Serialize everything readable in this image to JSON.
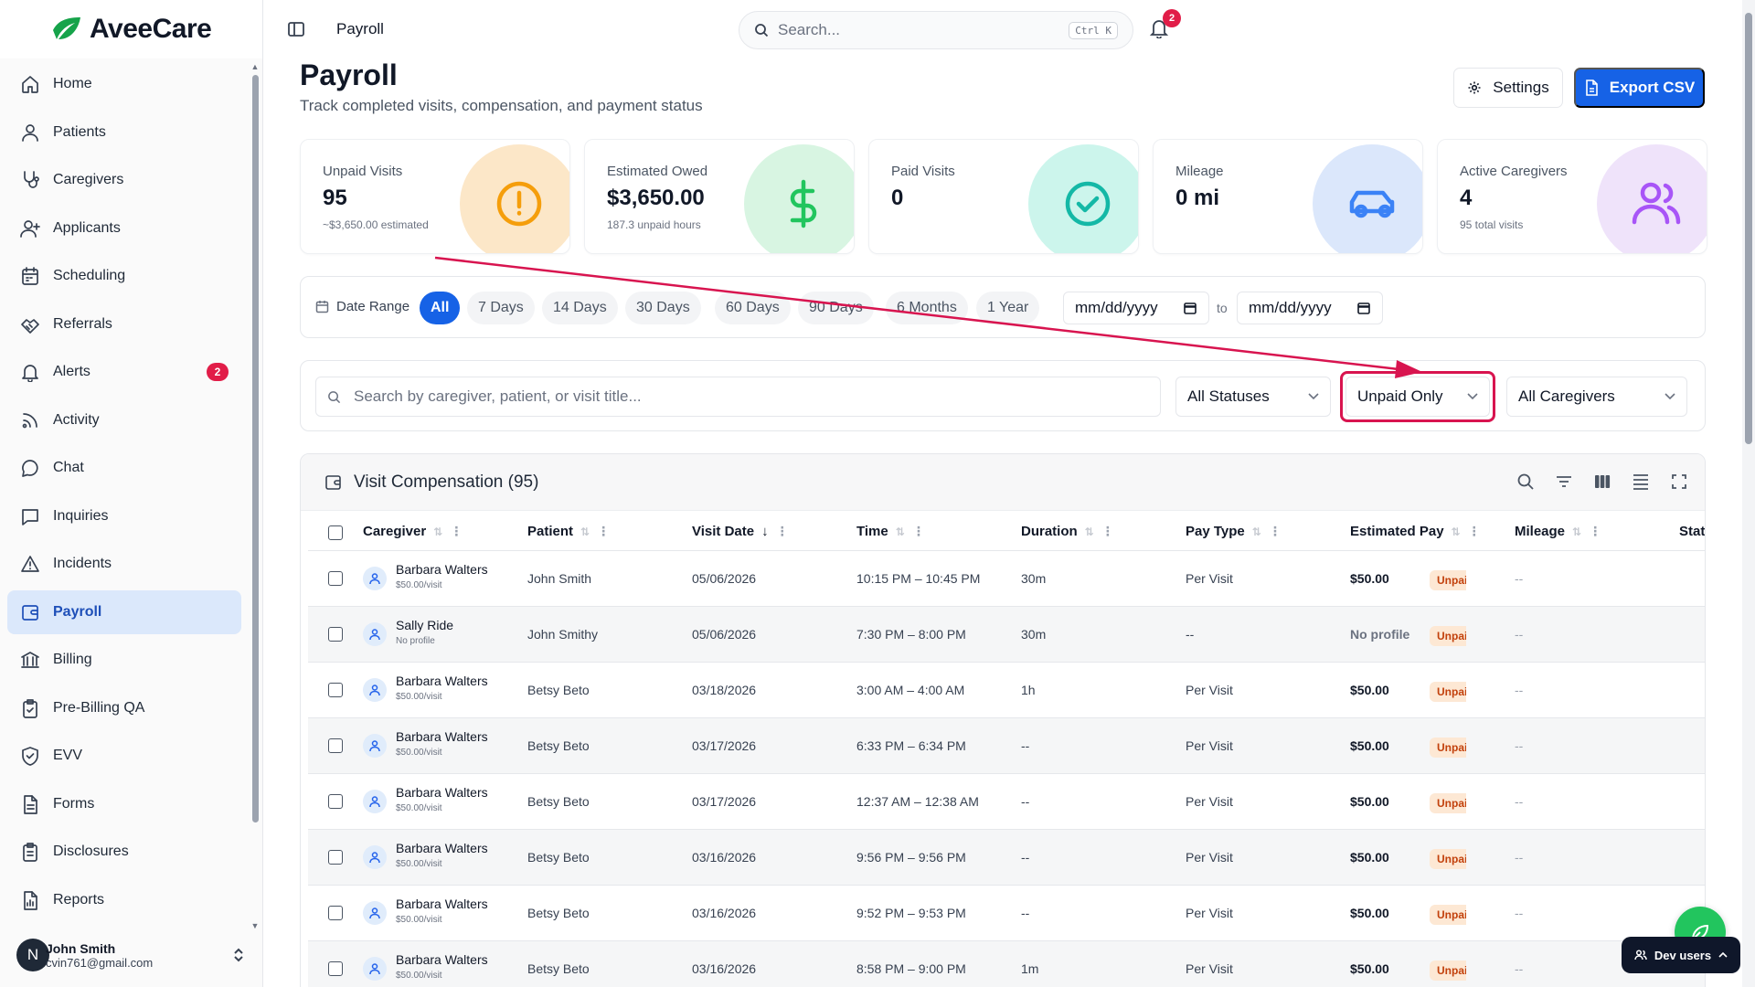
{
  "app": {
    "name": "AveeCare",
    "accent": "#1662e6",
    "highlight": "#d8144f"
  },
  "sidebar": {
    "items": [
      {
        "label": "Home",
        "icon": "home-icon"
      },
      {
        "label": "Patients",
        "icon": "user-icon"
      },
      {
        "label": "Caregivers",
        "icon": "stethoscope-icon"
      },
      {
        "label": "Applicants",
        "icon": "user-plus-icon"
      },
      {
        "label": "Scheduling",
        "icon": "calendar-icon"
      },
      {
        "label": "Referrals",
        "icon": "handshake-icon"
      },
      {
        "label": "Alerts",
        "icon": "bell-icon",
        "badge": "2"
      },
      {
        "label": "Activity",
        "icon": "rss-icon"
      },
      {
        "label": "Chat",
        "icon": "chat-bubble-icon"
      },
      {
        "label": "Inquiries",
        "icon": "message-square-icon"
      },
      {
        "label": "Incidents",
        "icon": "warning-triangle-icon"
      },
      {
        "label": "Payroll",
        "icon": "wallet-icon",
        "active": true
      },
      {
        "label": "Billing",
        "icon": "bank-icon"
      },
      {
        "label": "Pre-Billing QA",
        "icon": "clipboard-check-icon"
      },
      {
        "label": "EVV",
        "icon": "shield-check-icon"
      },
      {
        "label": "Forms",
        "icon": "document-icon"
      },
      {
        "label": "Disclosures",
        "icon": "clipboard-list-icon"
      },
      {
        "label": "Reports",
        "icon": "report-icon"
      }
    ],
    "user": {
      "initial": "N",
      "name": "John Smith",
      "email": "cvin761@gmail.com"
    }
  },
  "topbar": {
    "breadcrumb": "Payroll",
    "search_placeholder": "Search...",
    "shortcut": "Ctrl K",
    "notification_count": "2"
  },
  "header": {
    "title": "Payroll",
    "subtitle": "Track completed visits, compensation, and payment status",
    "settings_label": "Settings",
    "export_label": "Export CSV"
  },
  "stats": [
    {
      "label": "Unpaid Visits",
      "value": "95",
      "sub": "~$3,650.00 estimated",
      "icon": "alert-circle-icon",
      "color": "#fce7c8",
      "iconColor": "#f59e0b"
    },
    {
      "label": "Estimated Owed",
      "value": "$3,650.00",
      "sub": "187.3 unpaid hours",
      "icon": "dollar-icon",
      "color": "#d8f5e2",
      "iconColor": "#22c55e"
    },
    {
      "label": "Paid Visits",
      "value": "0",
      "sub": "",
      "icon": "check-circle-icon",
      "color": "#ccf5ec",
      "iconColor": "#14b8a6"
    },
    {
      "label": "Mileage",
      "value": "0 mi",
      "sub": "",
      "icon": "car-icon",
      "color": "#dbe7fb",
      "iconColor": "#3b82f6"
    },
    {
      "label": "Active Caregivers",
      "value": "4",
      "sub": "95 total visits",
      "icon": "users-icon",
      "color": "#efe3fa",
      "iconColor": "#a855f7"
    }
  ],
  "date_range": {
    "label": "Date Range",
    "chips": [
      "All",
      "7 Days",
      "14 Days",
      "30 Days",
      "60 Days",
      "90 Days",
      "6 Months",
      "1 Year"
    ],
    "active": "All",
    "from_placeholder": "mm/dd/yyyy",
    "to_label": "to",
    "to_placeholder": "mm/dd/yyyy"
  },
  "filters": {
    "search_placeholder": "Search by caregiver, patient, or visit title...",
    "status": "All Statuses",
    "payment": "Unpaid Only",
    "caregiver": "All Caregivers"
  },
  "table": {
    "title": "Visit Compensation (95)",
    "columns": [
      "Caregiver",
      "Patient",
      "Visit Date",
      "Time",
      "Duration",
      "Pay Type",
      "Estimated Pay",
      "Mileage",
      "Stat"
    ],
    "rows": [
      {
        "caregiver": "Barbara Walters",
        "rate": "$50.00/visit",
        "patient": "John Smith",
        "date": "05/06/2026",
        "time": "10:15 PM – 10:45 PM",
        "duration": "30m",
        "pay_type": "Per Visit",
        "pay": "$50.00",
        "mileage": "--",
        "status": "Unpaid"
      },
      {
        "caregiver": "Sally Ride",
        "rate": "No profile",
        "patient": "John Smithy",
        "date": "05/06/2026",
        "time": "7:30 PM – 8:00 PM",
        "duration": "30m",
        "pay_type": "--",
        "pay": "No profile",
        "mileage": "--",
        "status": "Unpaid"
      },
      {
        "caregiver": "Barbara Walters",
        "rate": "$50.00/visit",
        "patient": "Betsy Beto",
        "date": "03/18/2026",
        "time": "3:00 AM – 4:00 AM",
        "duration": "1h",
        "pay_type": "Per Visit",
        "pay": "$50.00",
        "mileage": "--",
        "status": "Unpaid"
      },
      {
        "caregiver": "Barbara Walters",
        "rate": "$50.00/visit",
        "patient": "Betsy Beto",
        "date": "03/17/2026",
        "time": "6:33 PM – 6:34 PM",
        "duration": "--",
        "pay_type": "Per Visit",
        "pay": "$50.00",
        "mileage": "--",
        "status": "Unpaid"
      },
      {
        "caregiver": "Barbara Walters",
        "rate": "$50.00/visit",
        "patient": "Betsy Beto",
        "date": "03/17/2026",
        "time": "12:37 AM – 12:38 AM",
        "duration": "--",
        "pay_type": "Per Visit",
        "pay": "$50.00",
        "mileage": "--",
        "status": "Unpaid"
      },
      {
        "caregiver": "Barbara Walters",
        "rate": "$50.00/visit",
        "patient": "Betsy Beto",
        "date": "03/16/2026",
        "time": "9:56 PM – 9:56 PM",
        "duration": "--",
        "pay_type": "Per Visit",
        "pay": "$50.00",
        "mileage": "--",
        "status": "Unpaid"
      },
      {
        "caregiver": "Barbara Walters",
        "rate": "$50.00/visit",
        "patient": "Betsy Beto",
        "date": "03/16/2026",
        "time": "9:52 PM – 9:53 PM",
        "duration": "--",
        "pay_type": "Per Visit",
        "pay": "$50.00",
        "mileage": "--",
        "status": "Unpaid"
      },
      {
        "caregiver": "Barbara Walters",
        "rate": "$50.00/visit",
        "patient": "Betsy Beto",
        "date": "03/16/2026",
        "time": "8:58 PM – 9:00 PM",
        "duration": "1m",
        "pay_type": "Per Visit",
        "pay": "$50.00",
        "mileage": "--",
        "status": "Unpaid"
      }
    ]
  },
  "floating": {
    "dev_users_label": "Dev users"
  }
}
